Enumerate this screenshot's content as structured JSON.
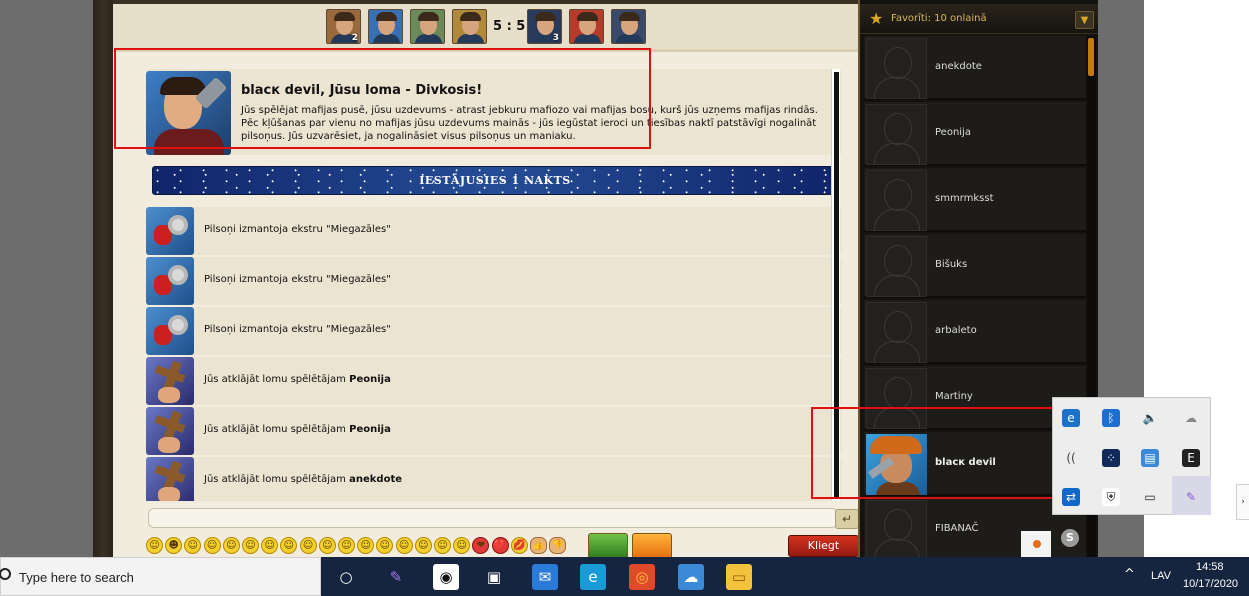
{
  "game": {
    "score": "5 : 5",
    "players_left": [
      {
        "count": "2"
      },
      {
        "count": ""
      },
      {
        "count": ""
      },
      {
        "count": ""
      }
    ],
    "players_right": [
      {
        "count": "3"
      },
      {
        "count": ""
      },
      {
        "count": ""
      }
    ],
    "role": {
      "title": "blacк devil, Jūsu loma - Divkosis!",
      "description": "Jūs spēlējat mafijas pusē, jūsu uzdevums - atrast jebkuru mafiozo vai mafijas bosu, kurš jūs uzņems mafijas rindās. Pēc kļūšanas par vienu no mafijas jūsu uzdevums mainās - jūs iegūstat ieroci un tiesības naktī patstāvīgi nogalināt pilsoņus. Jūs uzvarēsiet, ja nogalināsiet visus pilsoņus un maniaku."
    },
    "night_banner": "IESTĀJUSIES 1 NAKTS",
    "log": [
      {
        "icon": "sleeping-pills-icon",
        "text": "Pilsoņi izmantoja ekstru \"Miegazāles\"",
        "bold": ""
      },
      {
        "icon": "sleeping-pills-icon",
        "text": "Pilsoņi izmantoja ekstru \"Miegazāles\"",
        "bold": ""
      },
      {
        "icon": "sleeping-pills-icon",
        "text": "Pilsoņi izmantoja ekstru \"Miegazāles\"",
        "bold": ""
      },
      {
        "icon": "cross-icon",
        "text": "Jūs atklājāt lomu spēlētājam ",
        "bold": "Peonija"
      },
      {
        "icon": "cross-icon",
        "text": "Jūs atklājāt lomu spēlētājam ",
        "bold": "Peonija"
      },
      {
        "icon": "cross-icon",
        "text": "Jūs atklājāt lomu spēlētājam ",
        "bold": "anekdote"
      }
    ],
    "chat_input": {
      "value": "",
      "send_glyph": "↵"
    },
    "shout_button": "Kliegt",
    "emoji": [
      "☺",
      "☻",
      "☺",
      "☺",
      "☺",
      "☺",
      "☺",
      "☺",
      "☺",
      "☺",
      "☺",
      "☺",
      "☺",
      "☺",
      "☺",
      "☺",
      "☺",
      "❤",
      "💔",
      "💋",
      "👍",
      "👎"
    ]
  },
  "favorites": {
    "title": "Favorīti: 10 onlainā",
    "players": [
      {
        "name": "anekdote",
        "me": false
      },
      {
        "name": "Peonija",
        "me": false
      },
      {
        "name": "smmrmksst",
        "me": false
      },
      {
        "name": "Bišuks",
        "me": false
      },
      {
        "name": "arbaleto",
        "me": false
      },
      {
        "name": "Martiny",
        "me": false
      },
      {
        "name": "blacк devil",
        "me": true
      },
      {
        "name": "FIBANAČ",
        "me": false
      }
    ]
  },
  "tray_popup": {
    "icons": [
      "edge-update-icon",
      "bluetooth-icon",
      "volume-icon",
      "onedrive-icon",
      "wifi-icon",
      "dots-icon",
      "app-icon",
      "epic-games-icon",
      "teamviewer-icon",
      "defender-icon",
      "battery-icon",
      "feather-app-icon"
    ],
    "extra": "skype-icon"
  },
  "taskbar": {
    "search_placeholder": "Type here to search",
    "apps": [
      "cortana-icon",
      "feather-app-icon",
      "screenshot-app-icon",
      "store-icon",
      "mail-icon",
      "edge-icon",
      "chrome-icon",
      "vpn-icon",
      "file-explorer-icon"
    ],
    "lang": "LAV",
    "time": "14:58",
    "date": "10/17/2020"
  },
  "colors": {
    "highlight": "#e01010",
    "banner": "#254d96",
    "taskbar": "#15243f"
  }
}
